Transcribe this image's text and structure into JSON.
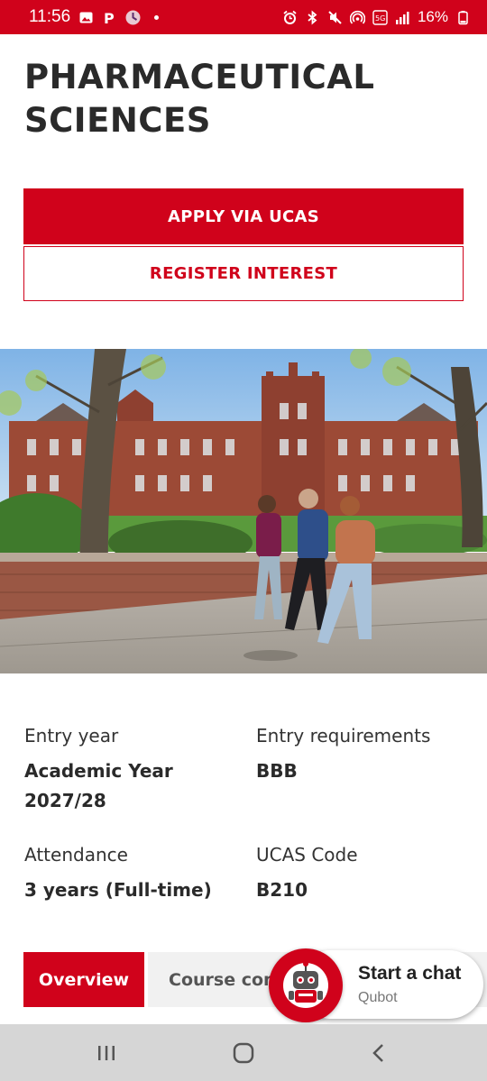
{
  "status_bar": {
    "time": "11:56",
    "battery": "16%",
    "icons": [
      "image-icon",
      "parking-icon",
      "app-icon",
      "dot-icon",
      "alarm-icon",
      "bluetooth-icon",
      "mute-icon",
      "hotspot-icon",
      "volte-icon",
      "signal-icon",
      "battery-icon"
    ]
  },
  "page": {
    "title": "PHARMACEUTICAL SCIENCES",
    "apply_label": "APPLY VIA UCAS",
    "register_label": "REGISTER INTEREST"
  },
  "info": {
    "entry_year_label": "Entry year",
    "entry_year_value": "Academic Year 2027/28",
    "entry_req_label": "Entry requirements",
    "entry_req_value": "BBB",
    "attendance_label": "Attendance",
    "attendance_value": "3 years (Full-time)",
    "ucas_label": "UCAS Code",
    "ucas_value": "B210"
  },
  "tabs": [
    {
      "label": "Overview",
      "active": true
    },
    {
      "label": "Course content",
      "active": false
    }
  ],
  "chat": {
    "title": "Start a chat",
    "subtitle": "Qubot"
  },
  "colors": {
    "brand_red": "#d0021b",
    "nav_bg": "#d6d6d6"
  },
  "nav": [
    "recents-icon",
    "home-icon",
    "back-icon"
  ]
}
